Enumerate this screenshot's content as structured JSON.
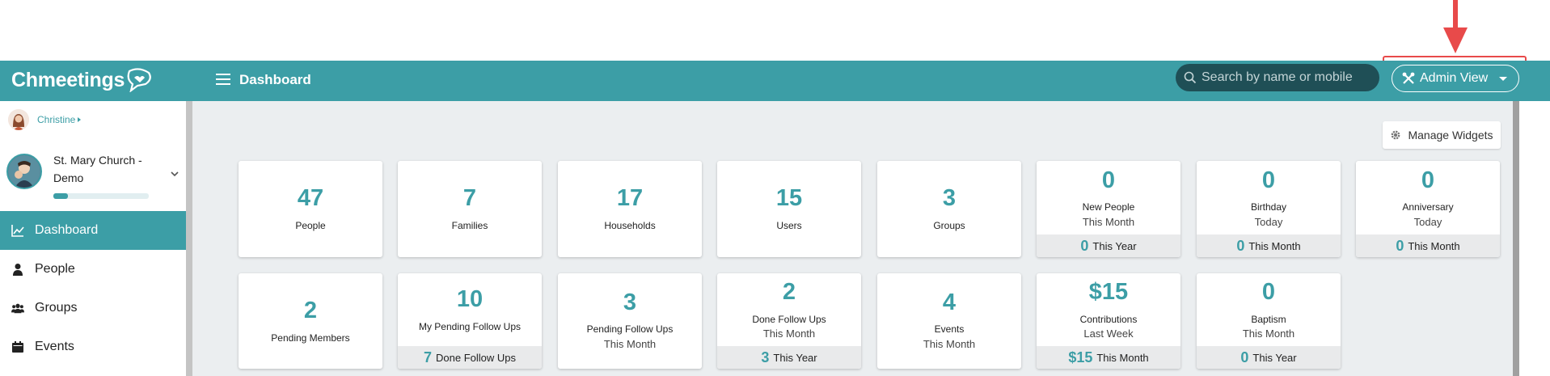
{
  "header": {
    "brand": "Chmeetings",
    "title": "Dashboard",
    "search_placeholder": "Search by name or mobile",
    "admin_label": "Admin View"
  },
  "sidebar": {
    "user_name": "Christine",
    "church_name": "St. Mary Church - Demo",
    "church_progress": 0.15,
    "items": [
      {
        "label": "Dashboard",
        "icon": "chart-line-icon"
      },
      {
        "label": "People",
        "icon": "person-icon"
      },
      {
        "label": "Groups",
        "icon": "users-icon"
      },
      {
        "label": "Events",
        "icon": "calendar-icon"
      }
    ]
  },
  "main": {
    "manage_label": "Manage Widgets",
    "row1": [
      {
        "value": "47",
        "label": "People"
      },
      {
        "value": "7",
        "label": "Families"
      },
      {
        "value": "17",
        "label": "Households"
      },
      {
        "value": "15",
        "label": "Users"
      },
      {
        "value": "3",
        "label": "Groups"
      },
      {
        "value": "0",
        "label": "New People",
        "sub": "This Month",
        "foot_value": "0",
        "foot_label": "This Year"
      },
      {
        "value": "0",
        "label": "Birthday",
        "sub": "Today",
        "foot_value": "0",
        "foot_label": "This Month"
      },
      {
        "value": "0",
        "label": "Anniversary",
        "sub": "Today",
        "foot_value": "0",
        "foot_label": "This Month"
      }
    ],
    "row2": [
      {
        "value": "2",
        "label": "Pending Members"
      },
      {
        "value": "10",
        "label": "My Pending Follow Ups",
        "foot_value": "7",
        "foot_label": "Done Follow Ups"
      },
      {
        "value": "3",
        "label": "Pending Follow Ups",
        "sub": "This Month"
      },
      {
        "value": "2",
        "label": "Done Follow Ups",
        "sub": "This Month",
        "foot_value": "3",
        "foot_label": "This Year"
      },
      {
        "value": "4",
        "label": "Events",
        "sub": "This Month"
      },
      {
        "value": "$15",
        "label": "Contributions",
        "sub": "Last Week",
        "foot_value": "$15",
        "foot_label": "This Month"
      },
      {
        "value": "0",
        "label": "Baptism",
        "sub": "This Month",
        "foot_value": "0",
        "foot_label": "This Year"
      }
    ]
  },
  "colors": {
    "brand": "#3c9ea6",
    "search_bg": "#1f4f56",
    "annotation": "#e84a4a"
  }
}
